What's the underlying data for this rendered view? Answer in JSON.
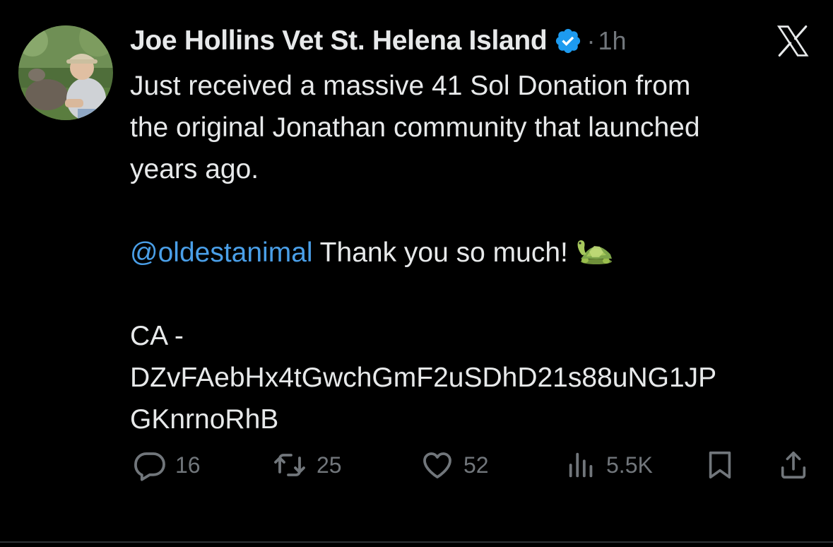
{
  "author": {
    "display_name": "Joe Hollins Vet St. Helena Island",
    "verified": true,
    "avatar_icon": "avatar-photo"
  },
  "meta": {
    "separator": "·",
    "timestamp": "1h"
  },
  "body": {
    "line1": "Just received a massive 41 Sol Donation from",
    "line2": "the original Jonathan community that launched",
    "line3": "years ago.",
    "mention": "@oldestanimal",
    "thanks": " Thank you so much!",
    "emoji_icon": "turtle-icon",
    "ca_label": "CA -",
    "ca_line1": "DZvFAebHx4tGwchGmF2uSDhD21s88uNG1JP",
    "ca_line2": "GKnrnoRhB"
  },
  "actions": {
    "replies": "16",
    "reposts": "25",
    "likes": "52",
    "views": "5.5K"
  },
  "colors": {
    "background": "#000000",
    "text": "#e7e9ea",
    "muted": "#71767b",
    "link": "#4a9fe8",
    "verified": "#1d9bf0"
  }
}
